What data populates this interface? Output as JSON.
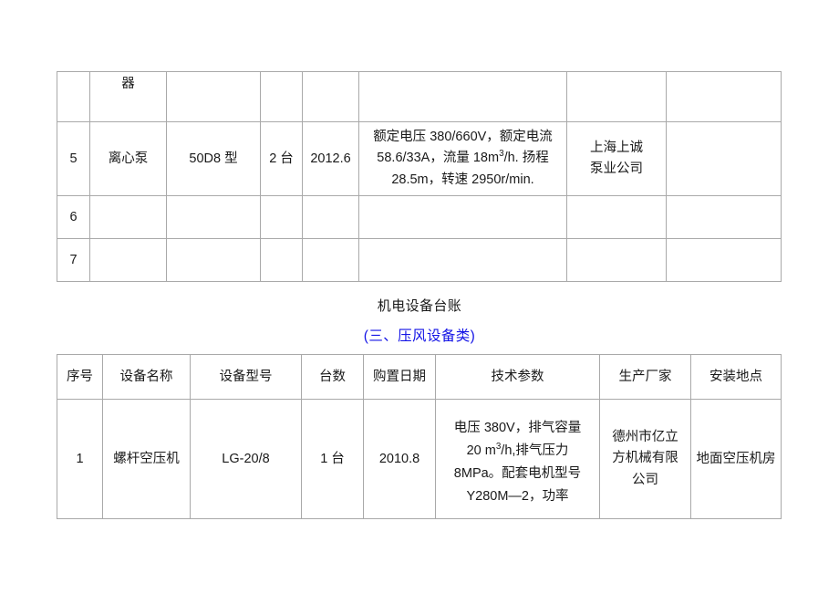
{
  "document": {
    "title": "机电设备台账",
    "subtitle": "(三、压风设备类)",
    "subtitle_color": "#1414e6"
  },
  "table_top": {
    "continuation_row": {
      "seq": "",
      "name": "器",
      "model": "",
      "qty": "",
      "date": "",
      "tech": "",
      "maker": "",
      "place": ""
    },
    "rows": [
      {
        "seq": "5",
        "name": "离心泵",
        "model": "50D8 型",
        "qty": "2 台",
        "date": "2012.6",
        "tech_lines": [
          "额定电压 380/660V，额定电流",
          "58.6/33A，流量 18m³/h. 扬程",
          "28.5m，转速 2950r/min."
        ],
        "maker_lines": [
          "上海上诚",
          "泵业公司"
        ],
        "place": ""
      },
      {
        "seq": "6",
        "name": "",
        "model": "",
        "qty": "",
        "date": "",
        "tech_lines": [],
        "maker_lines": [],
        "place": ""
      },
      {
        "seq": "7",
        "name": "",
        "model": "",
        "qty": "",
        "date": "",
        "tech_lines": [],
        "maker_lines": [],
        "place": ""
      }
    ]
  },
  "table_bottom": {
    "headers": [
      "序号",
      "设备名称",
      "设备型号",
      "台数",
      "购置日期",
      "技术参数",
      "生产厂家",
      "安装地点"
    ],
    "rows": [
      {
        "seq": "1",
        "name": "螺杆空压机",
        "model": "LG-20/8",
        "qty": "1 台",
        "date": "2010.8",
        "tech_lines": [
          "电压 380V，排气容量",
          "20 m³/h,排气压力",
          "8MPa。配套电机型号",
          "Y280M—2，功率"
        ],
        "maker_lines": [
          "德州市亿立",
          "方机械有限",
          "公司"
        ],
        "place": "地面空压机房"
      }
    ]
  }
}
